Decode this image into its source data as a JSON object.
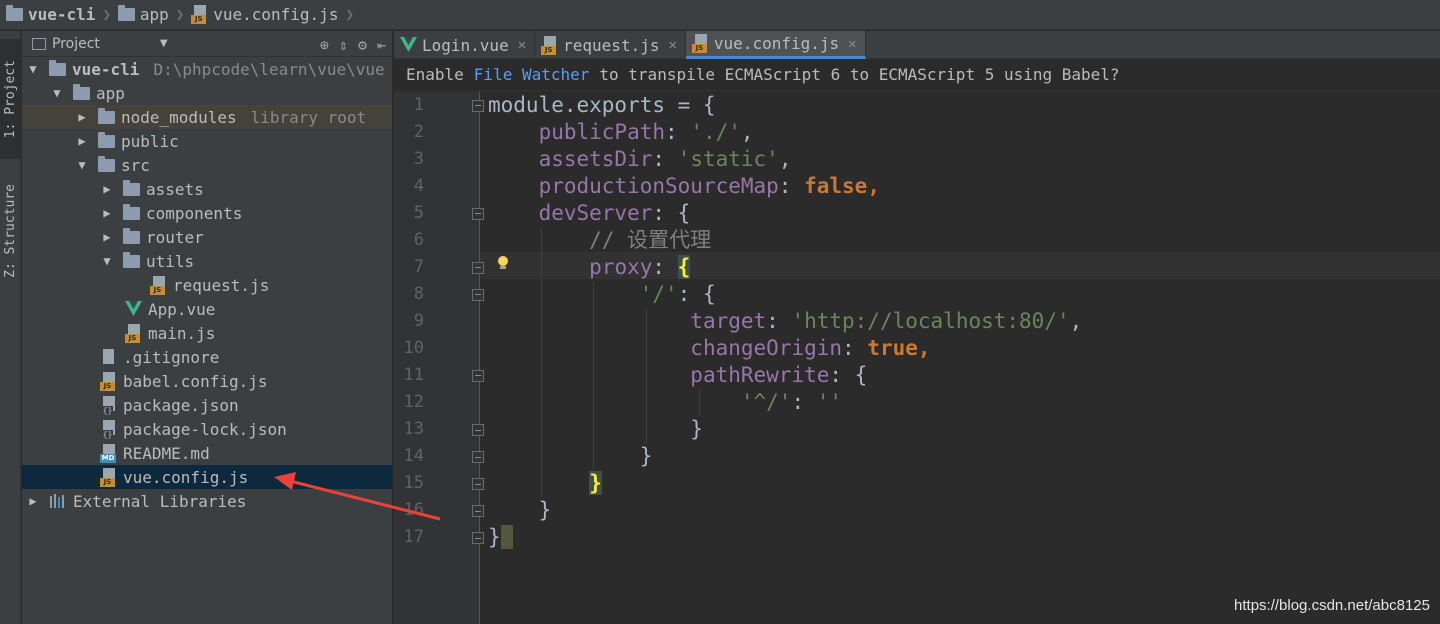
{
  "breadcrumb": {
    "items": [
      "vue-cli",
      "app",
      "vue.config.js"
    ]
  },
  "toolstrip": {
    "project_tab": "1: Project",
    "structure_tab": "Z: Structure"
  },
  "project_panel": {
    "title": "Project",
    "tools": [
      "target-icon",
      "collapse-icon",
      "gear-icon",
      "hide-icon"
    ],
    "tree": [
      {
        "label": "vue-cli",
        "path": "D:\\phpcode\\learn\\vue\\vue",
        "expanded": true
      },
      {
        "label": "app",
        "expanded": true
      },
      {
        "label": "node_modules",
        "hint": "library root",
        "expanded": false
      },
      {
        "label": "public",
        "expanded": false
      },
      {
        "label": "src",
        "expanded": true
      },
      {
        "label": "assets",
        "expanded": false
      },
      {
        "label": "components",
        "expanded": false
      },
      {
        "label": "router",
        "expanded": false
      },
      {
        "label": "utils",
        "expanded": true
      },
      {
        "label": "request.js"
      },
      {
        "label": "App.vue"
      },
      {
        "label": "main.js"
      },
      {
        "label": ".gitignore"
      },
      {
        "label": "babel.config.js"
      },
      {
        "label": "package.json"
      },
      {
        "label": "package-lock.json"
      },
      {
        "label": "README.md"
      },
      {
        "label": "vue.config.js",
        "selected": true
      },
      {
        "label": "External Libraries",
        "expanded": false
      }
    ]
  },
  "tabs": [
    {
      "label": "Login.vue",
      "icon": "vue-icon"
    },
    {
      "label": "request.js",
      "icon": "js-icon"
    },
    {
      "label": "vue.config.js",
      "icon": "js-icon",
      "active": true
    }
  ],
  "notice": {
    "prefix": "Enable",
    "link": "File Watcher",
    "suffix": "to transpile ECMAScript 6 to ECMAScript 5 using Babel?"
  },
  "editor": {
    "line_numbers": [
      "1",
      "2",
      "3",
      "4",
      "5",
      "6",
      "7",
      "8",
      "9",
      "10",
      "11",
      "12",
      "13",
      "14",
      "15",
      "16",
      "17"
    ],
    "lines": [
      {
        "parts": [
          [
            "plain",
            "module.exports = {"
          ]
        ]
      },
      {
        "parts": [
          [
            "plain",
            "    "
          ],
          [
            "prop",
            "publicPath"
          ],
          [
            "plain",
            ": "
          ],
          [
            "str",
            "'./'"
          ],
          [
            "plain",
            ","
          ]
        ]
      },
      {
        "parts": [
          [
            "plain",
            "    "
          ],
          [
            "prop",
            "assetsDir"
          ],
          [
            "plain",
            ": "
          ],
          [
            "str",
            "'static'"
          ],
          [
            "plain",
            ","
          ]
        ]
      },
      {
        "parts": [
          [
            "plain",
            "    "
          ],
          [
            "prop",
            "productionSourceMap"
          ],
          [
            "plain",
            ": "
          ],
          [
            "kw",
            "false"
          ],
          [
            "kw",
            ","
          ]
        ]
      },
      {
        "parts": [
          [
            "plain",
            "    "
          ],
          [
            "prop",
            "devServer"
          ],
          [
            "plain",
            ": {"
          ]
        ]
      },
      {
        "parts": [
          [
            "plain",
            "        "
          ],
          [
            "comment",
            "// 设置代理"
          ]
        ]
      },
      {
        "parts": [
          [
            "plain",
            "        "
          ],
          [
            "prop",
            "proxy"
          ],
          [
            "plain",
            ": "
          ],
          [
            "brace",
            "{"
          ]
        ]
      },
      {
        "parts": [
          [
            "plain",
            "            "
          ],
          [
            "str",
            "'/'"
          ],
          [
            "plain",
            ": {"
          ]
        ]
      },
      {
        "parts": [
          [
            "plain",
            "                "
          ],
          [
            "prop",
            "target"
          ],
          [
            "plain",
            ": "
          ],
          [
            "str",
            "'http://localhost:80/'"
          ],
          [
            "plain",
            ","
          ]
        ]
      },
      {
        "parts": [
          [
            "plain",
            "                "
          ],
          [
            "prop",
            "changeOrigin"
          ],
          [
            "plain",
            ": "
          ],
          [
            "kw",
            "true"
          ],
          [
            "kw",
            ","
          ]
        ]
      },
      {
        "parts": [
          [
            "plain",
            "                "
          ],
          [
            "prop",
            "pathRewrite"
          ],
          [
            "plain",
            ": {"
          ]
        ]
      },
      {
        "parts": [
          [
            "plain",
            "                    "
          ],
          [
            "str",
            "'^/'"
          ],
          [
            "plain",
            ": "
          ],
          [
            "str",
            "''"
          ]
        ]
      },
      {
        "parts": [
          [
            "plain",
            "                }"
          ]
        ]
      },
      {
        "parts": [
          [
            "plain",
            "            }"
          ]
        ]
      },
      {
        "parts": [
          [
            "plain",
            "        "
          ],
          [
            "brace",
            "}"
          ]
        ]
      },
      {
        "parts": [
          [
            "plain",
            "    }"
          ]
        ]
      },
      {
        "parts": [
          [
            "plain",
            "}"
          ],
          [
            "cursor",
            " "
          ]
        ]
      }
    ]
  },
  "watermark": "https://blog.csdn.net/abc8125",
  "colors": {
    "keyword": "#cc7832",
    "property": "#9876aa",
    "string": "#6a8759",
    "comment": "#808080",
    "selection": "#0d293e",
    "arrow": "#e8423a"
  }
}
